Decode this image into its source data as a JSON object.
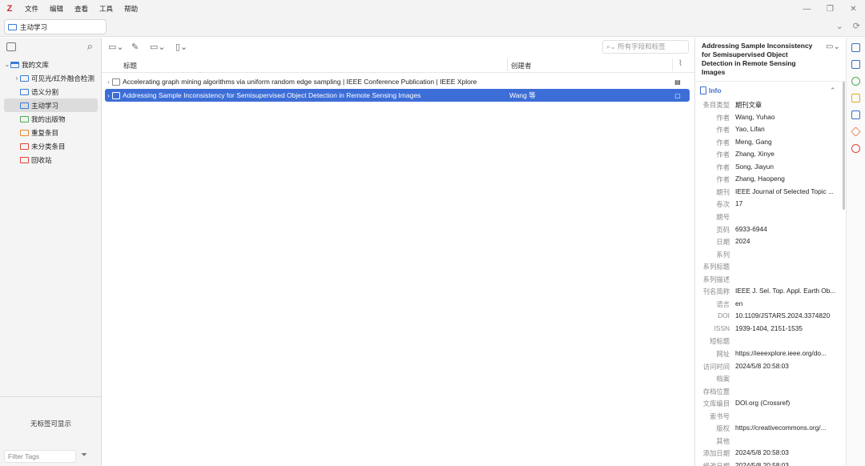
{
  "app": {
    "logo": "Z"
  },
  "menu": [
    "文件",
    "编辑",
    "查看",
    "工具",
    "帮助"
  ],
  "tab": {
    "label": "主动学习"
  },
  "sidebar": {
    "items": [
      {
        "label": "我的文库",
        "twisty": "⌄",
        "icon": "library-icon"
      },
      {
        "label": "可见光/红外融合检测",
        "twisty": "›",
        "icon": "folder-icon"
      },
      {
        "label": "语义分割",
        "twisty": "",
        "icon": "folder-icon"
      },
      {
        "label": "主动学习",
        "twisty": "",
        "icon": "folder-icon"
      },
      {
        "label": "我的出版物",
        "twisty": "",
        "icon": "publications-icon"
      },
      {
        "label": "重复条目",
        "twisty": "",
        "icon": "duplicates-icon"
      },
      {
        "label": "未分类条目",
        "twisty": "",
        "icon": "unfiled-icon"
      },
      {
        "label": "回收站",
        "twisty": "",
        "icon": "trash-icon"
      }
    ],
    "no_tags": "无标签可显示",
    "filter_placeholder": "Filter Tags"
  },
  "items_pane": {
    "search_placeholder": "所有字段和标签",
    "columns": {
      "title": "标题",
      "creator": "创建者"
    },
    "rows": [
      {
        "title": "Accelerating graph mining algorithms via uniform random edge sampling | IEEE Conference Publication | IEEE Xplore",
        "creator": "",
        "type_icon": "webpage-icon"
      },
      {
        "title": "Addressing Sample Inconsistency for Semisupervised Object Detection in Remote Sensing Images",
        "creator": "Wang 等",
        "type_icon": "journal-article-icon"
      }
    ]
  },
  "item_pane": {
    "title": "Addressing Sample Inconsistency for Semisupervised Object Detection in Remote Sensing Images",
    "section": "Info",
    "fields": [
      {
        "label": "条目类型",
        "value": "期刊文章"
      },
      {
        "label": "作者",
        "value": "Wang, Yuhao"
      },
      {
        "label": "作者",
        "value": "Yao, Lifan"
      },
      {
        "label": "作者",
        "value": "Meng, Gang"
      },
      {
        "label": "作者",
        "value": "Zhang, Xinye"
      },
      {
        "label": "作者",
        "value": "Song, Jiayun"
      },
      {
        "label": "作者",
        "value": "Zhang, Haopeng"
      },
      {
        "label": "期刊",
        "value": "IEEE Journal of Selected Topic ..."
      },
      {
        "label": "卷次",
        "value": "17"
      },
      {
        "label": "期号",
        "value": ""
      },
      {
        "label": "页码",
        "value": "6933-6944"
      },
      {
        "label": "日期",
        "value": "2024"
      },
      {
        "label": "系列",
        "value": ""
      },
      {
        "label": "系列标题",
        "value": ""
      },
      {
        "label": "系列描述",
        "value": ""
      },
      {
        "label": "刊名简称",
        "value": "IEEE J. Sel. Top. Appl. Earth Ob..."
      },
      {
        "label": "语言",
        "value": "en"
      },
      {
        "label": "DOI",
        "value": "10.1109/JSTARS.2024.3374820"
      },
      {
        "label": "ISSN",
        "value": "1939-1404, 2151-1535"
      },
      {
        "label": "短标题",
        "value": ""
      },
      {
        "label": "网址",
        "value": "https://ieeexplore.ieee.org/do..."
      },
      {
        "label": "访问时间",
        "value": "2024/5/8 20:58:03"
      },
      {
        "label": "档案",
        "value": ""
      },
      {
        "label": "存档位置",
        "value": ""
      },
      {
        "label": "文库编目",
        "value": "DOI.org (Crossref)"
      },
      {
        "label": "索书号",
        "value": ""
      },
      {
        "label": "版权",
        "value": "https://creativecommons.org/..."
      },
      {
        "label": "其他",
        "value": ""
      },
      {
        "label": "添加日期",
        "value": "2024/5/8 20:58:03"
      },
      {
        "label": "修改日期",
        "value": "2024/5/8 20:58:03"
      }
    ]
  },
  "colors": {
    "accent": "#3d6ed7",
    "logo": "#cc2936"
  }
}
